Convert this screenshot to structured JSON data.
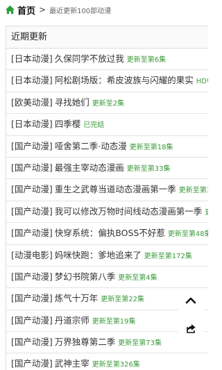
{
  "breadcrumb": {
    "home_label": "首页",
    "separator": ">",
    "current": "最近更新100部动漫"
  },
  "panel": {
    "title": "近期更新"
  },
  "items": [
    {
      "category": "[日本动漫]",
      "title": "久保同学不放过我",
      "status": "更新至第6集"
    },
    {
      "category": "[日本动漫]",
      "title": "阿松剧场版：希皮波族与闪耀的果实",
      "status": "HD中字"
    },
    {
      "category": "[欧美动漫]",
      "title": "寻找她们",
      "status": "更新至2集"
    },
    {
      "category": "[日本动漫]",
      "title": "四季樱",
      "status": "已完结"
    },
    {
      "category": "[国产动漫]",
      "title": "哑舍第二季·动态漫",
      "status": "更新至第18集"
    },
    {
      "category": "[国产动漫]",
      "title": "最强主宰动态漫画",
      "status": "更新至第33集"
    },
    {
      "category": "[国产动漫]",
      "title": "重生之武尊当道动态漫画第一季",
      "status": "更新至第39集"
    },
    {
      "category": "[国产动漫]",
      "title": "我可以修改万物时间线动态漫画第一季",
      "status": "更新至"
    },
    {
      "category": "[国产动漫]",
      "title": "快穿系统：偏执BOSS不好惹",
      "status": "更新至第48集"
    },
    {
      "category": "[动漫电影]",
      "title": "妈咪快跑：爹地追来了",
      "status": "更新至第172集"
    },
    {
      "category": "[国产动漫]",
      "title": "梦幻书院第八季",
      "status": "更新至第4集"
    },
    {
      "category": "[国产动漫]",
      "title": "炼气十万年",
      "status": "更新至第22集"
    },
    {
      "category": "[国产动漫]",
      "title": "丹道宗师",
      "status": "更新至第19集"
    },
    {
      "category": "[国产动漫]",
      "title": "万界独尊第二季",
      "status": "更新至第73集"
    },
    {
      "category": "[国产动漫]",
      "title": "武神主宰",
      "status": "更新至第326集"
    }
  ],
  "icons": {
    "home": "home-icon",
    "scroll_top": "arrow-up-icon",
    "share": "share-icon"
  },
  "colors": {
    "home_icon": "#2e9e3a",
    "status_text": "#3a9a3a"
  }
}
